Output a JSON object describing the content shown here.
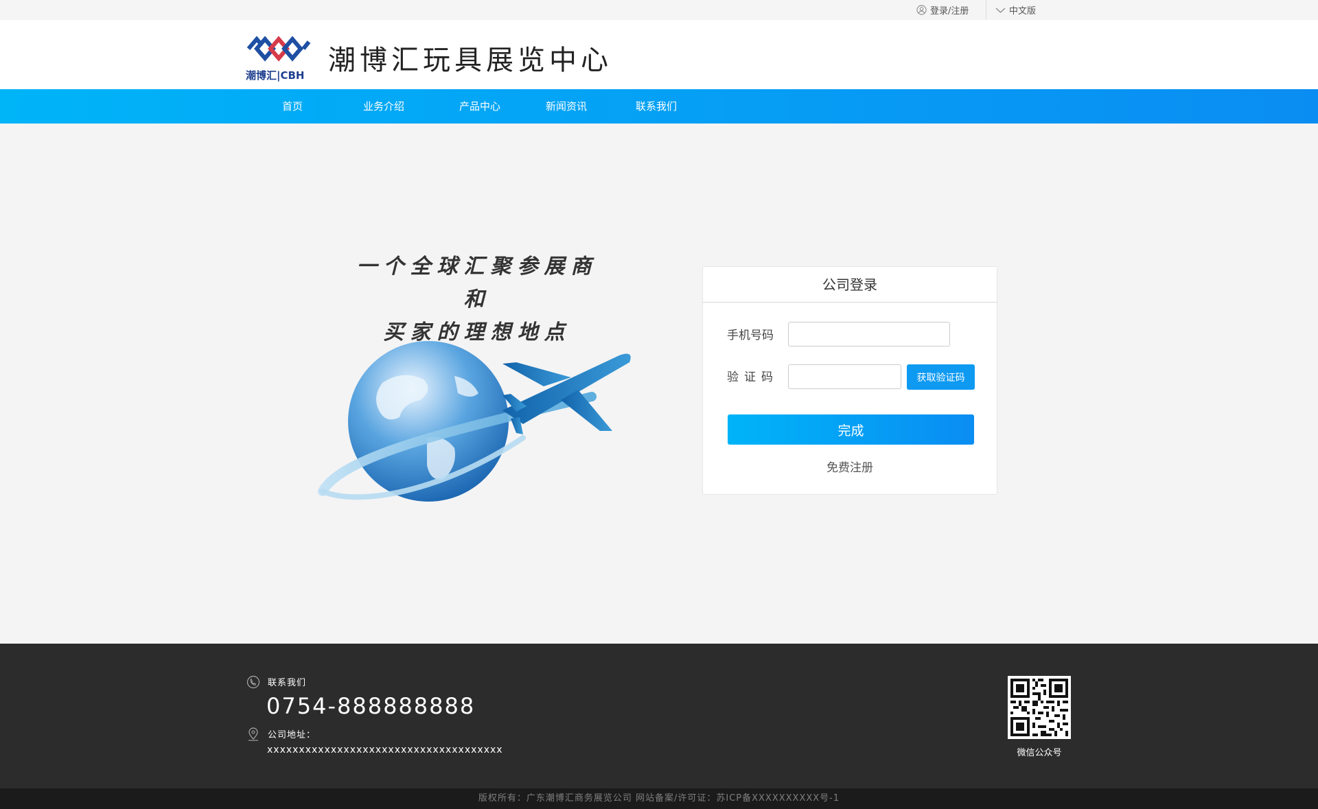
{
  "topbar": {
    "login_register": "登录/注册",
    "language": "中文版"
  },
  "header": {
    "logo_caption": "潮博汇|CBH",
    "site_title": "潮博汇玩具展览中心"
  },
  "nav": {
    "items": [
      "首页",
      "业务介绍",
      "产品中心",
      "新闻资讯",
      "联系我们"
    ]
  },
  "hero": {
    "slogan_line1": "一个全球汇聚参展商和",
    "slogan_line2": "买家的理想地点"
  },
  "login": {
    "title": "公司登录",
    "phone_label": "手机号码",
    "phone_value": "",
    "code_label": "验证码",
    "code_value": "",
    "get_code_button": "获取验证码",
    "submit_button": "完成",
    "register_link": "免费注册"
  },
  "footer": {
    "contact_label": "联系我们",
    "phone": "0754-888888888",
    "address_label": "公司地址：",
    "address_value": "xxxxxxxxxxxxxxxxxxxxxxxxxxxxxxxxxxxxx",
    "qr_caption": "微信公众号",
    "copyright": "版权所有：广东潮博汇商务展览公司  网站备案/许可证：苏ICP备XXXXXXXXXX号-1"
  },
  "colors": {
    "brand_blue": "#0a8df2",
    "brand_cyan": "#00b4f8",
    "footer_bg": "#2d2c2c"
  }
}
